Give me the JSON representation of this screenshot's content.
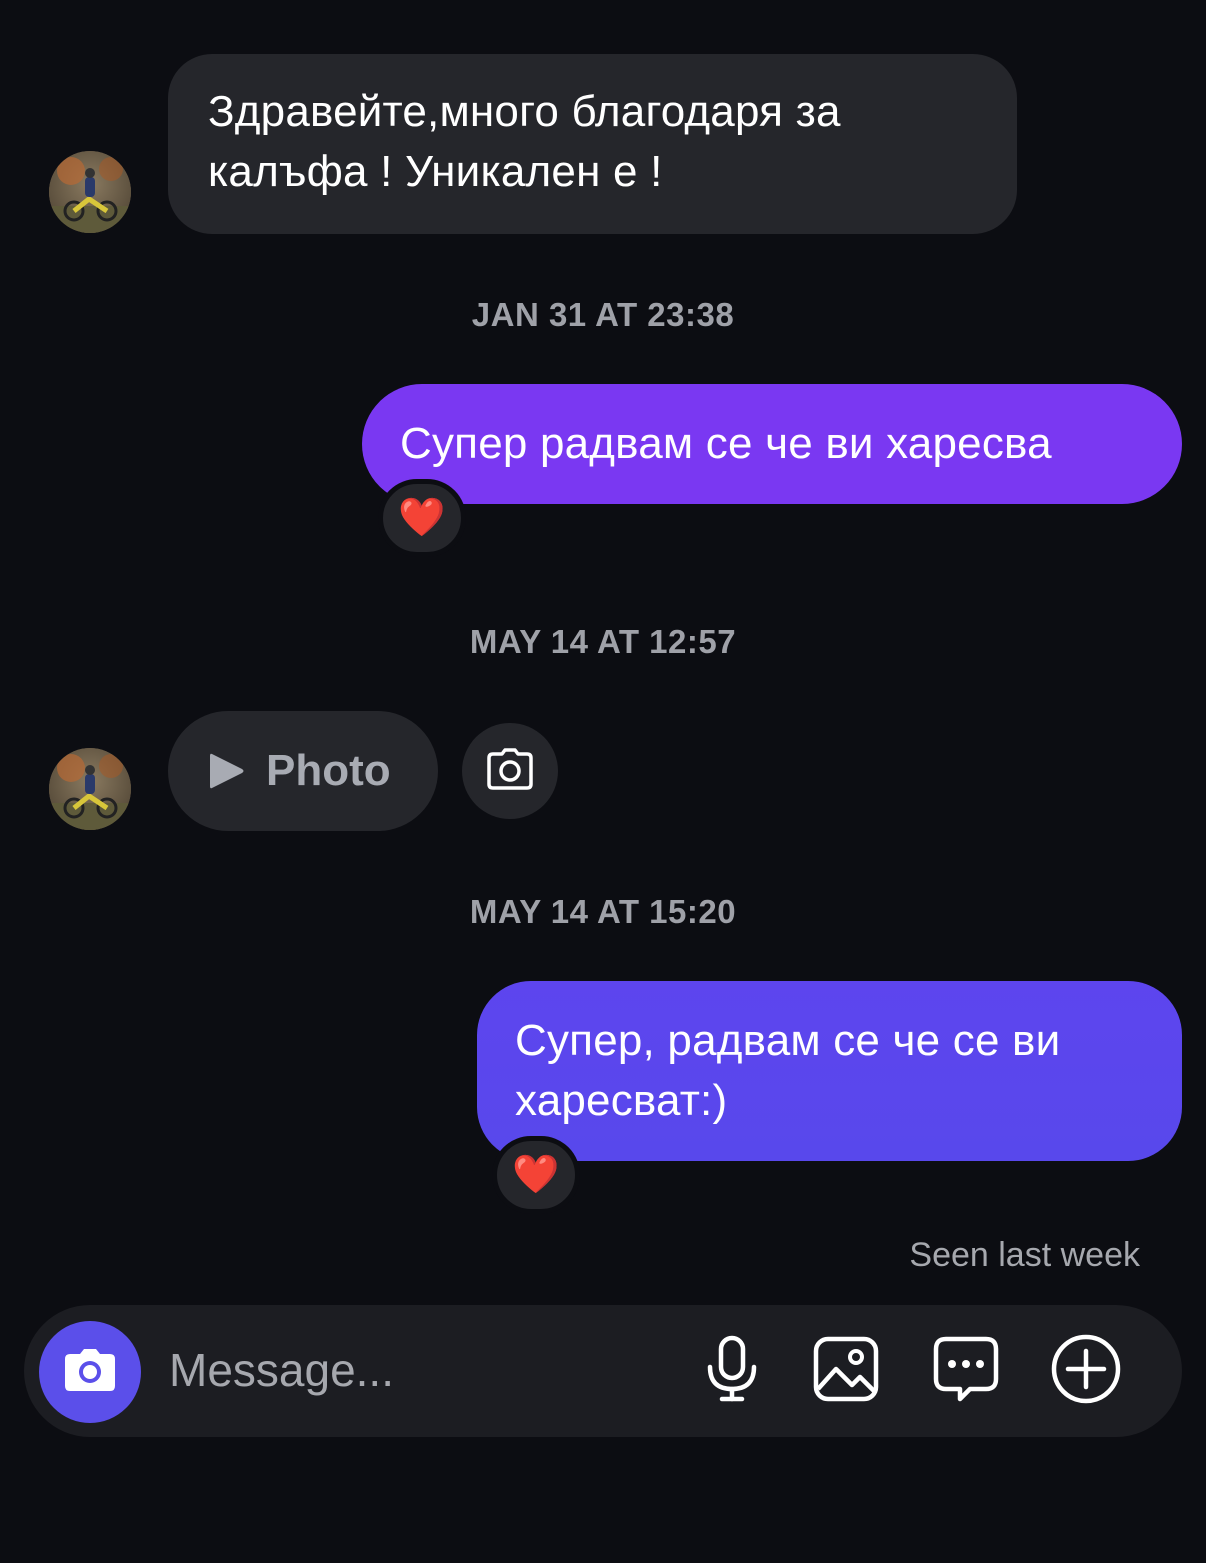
{
  "colors": {
    "background": "#0c0d12",
    "incoming_bubble": "#25262b",
    "outgoing_gradient_top": "#7a38f2",
    "outgoing_gradient_bottom": "#5a45ee",
    "timestamp": "#9fa1a8",
    "accent": "#5b4fea"
  },
  "messages": [
    {
      "direction": "incoming",
      "text_line1": "Здравейте,много благодаря за",
      "text_line2": "калъфа ! Уникален е !"
    },
    {
      "timestamp": "JAN 31 AT 23:38"
    },
    {
      "direction": "outgoing",
      "text": "Супер радвам се че ви харесва",
      "reaction": "❤️"
    },
    {
      "timestamp": "MAY 14 AT 12:57"
    },
    {
      "direction": "incoming",
      "type": "photo",
      "label": "Photo",
      "icon": "play-icon",
      "side_action_icon": "camera-icon"
    },
    {
      "timestamp": "MAY 14 AT 15:20"
    },
    {
      "direction": "outgoing",
      "text_line1": "Супер, радвам се че се ви",
      "text_line2": "харесват:)",
      "reaction": "❤️"
    }
  ],
  "seen_status": "Seen last week",
  "composer": {
    "placeholder": "Message...",
    "icons": [
      "camera-icon",
      "microphone-icon",
      "gallery-icon",
      "sticker-chat-icon",
      "plus-circle-icon"
    ]
  }
}
